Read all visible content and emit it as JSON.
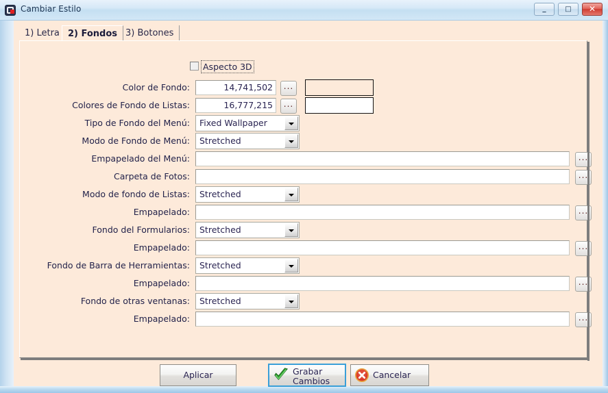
{
  "window": {
    "title": "Cambiar Estilo",
    "icon": "app-logo-icon",
    "controls": {
      "minimize": "–",
      "maximize": "□",
      "close": "✕"
    }
  },
  "tabs": [
    {
      "label": "1) Letra",
      "active": false
    },
    {
      "label": "2) Fondos",
      "active": true
    },
    {
      "label": "3) Botones",
      "active": false
    }
  ],
  "checkbox": {
    "label": "Aspecto 3D",
    "checked": false
  },
  "browse_label": "...",
  "form": {
    "rows": [
      {
        "label": "Color de Fondo:",
        "type": "number-color",
        "value": "14,741,502",
        "swatch_color": "#fdeada"
      },
      {
        "label": "Colores de Fondo de Listas:",
        "type": "number-color",
        "value": "16,777,215",
        "swatch_color": "#ffffff"
      },
      {
        "label": "Tipo de Fondo del Menú:",
        "type": "combo",
        "value": "Fixed Wallpaper"
      },
      {
        "label": "Modo de Fondo de Menú:",
        "type": "combo",
        "value": "Stretched"
      },
      {
        "label": "Empapelado del Menú:",
        "type": "text-browse",
        "value": ""
      },
      {
        "label": "Carpeta de Fotos:",
        "type": "text-browse",
        "value": ""
      },
      {
        "label": "Modo de fondo de Listas:",
        "type": "combo",
        "value": "Stretched"
      },
      {
        "label": "Empapelado:",
        "type": "text-browse",
        "value": ""
      },
      {
        "label": "Fondo del Formularios:",
        "type": "combo",
        "value": "Stretched"
      },
      {
        "label": "Empapelado:",
        "type": "text-browse",
        "value": ""
      },
      {
        "label": "Fondo de Barra de Herramientas:",
        "type": "combo",
        "value": "Stretched"
      },
      {
        "label": "Empapelado:",
        "type": "text-browse",
        "value": ""
      },
      {
        "label": "Fondo de otras ventanas:",
        "type": "combo",
        "value": "Stretched"
      },
      {
        "label": "Empapelado:",
        "type": "text-browse",
        "value": ""
      }
    ]
  },
  "buttons": {
    "apply": "Aplicar",
    "save_line1": "Grabar",
    "save_line2": "Cambios",
    "cancel": "Cancelar"
  },
  "colors": {
    "form_background": "#fdeada",
    "accent_focus": "#3a9fd8",
    "label_text": "#22224a",
    "titlebar_text": "#1b3452"
  }
}
